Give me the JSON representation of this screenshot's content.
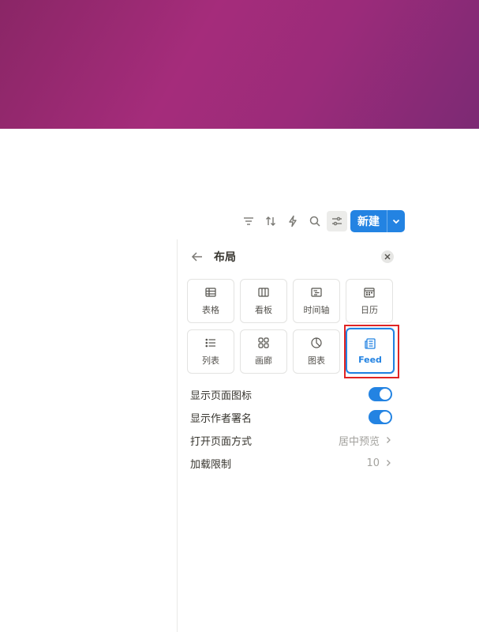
{
  "toolbar": {
    "icons": [
      "filter-icon",
      "sort-icon",
      "lightning-icon",
      "search-icon",
      "sliders-icon"
    ],
    "new_label": "新建"
  },
  "panel": {
    "title": "布局",
    "layouts": [
      {
        "label": "表格",
        "icon": "table-icon"
      },
      {
        "label": "看板",
        "icon": "board-icon"
      },
      {
        "label": "时间轴",
        "icon": "timeline-icon"
      },
      {
        "label": "日历",
        "icon": "calendar-icon"
      },
      {
        "label": "列表",
        "icon": "list-icon"
      },
      {
        "label": "画廊",
        "icon": "gallery-icon"
      },
      {
        "label": "图表",
        "icon": "chart-icon"
      },
      {
        "label": "Feed",
        "icon": "feed-icon",
        "selected": true
      }
    ],
    "options": [
      {
        "label": "显示页面图标",
        "type": "toggle",
        "on": true
      },
      {
        "label": "显示作者署名",
        "type": "toggle",
        "on": true
      },
      {
        "label": "打开页面方式",
        "type": "select",
        "value": "居中预览"
      },
      {
        "label": "加载限制",
        "type": "select",
        "value": "10"
      }
    ]
  },
  "colors": {
    "accent": "#2383e2",
    "highlight": "#e02424",
    "cover_start": "#8a2666",
    "cover_end": "#7c2a74"
  }
}
